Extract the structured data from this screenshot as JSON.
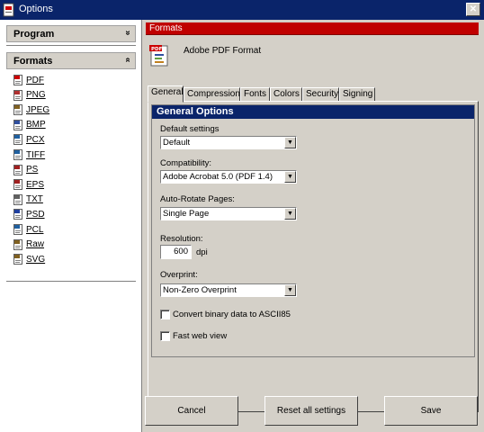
{
  "window": {
    "title": "Options",
    "close_glyph": "✕"
  },
  "sidebar": {
    "program_label": "Program",
    "program_chevron": "»",
    "formats_label": "Formats",
    "formats_chevron": "«",
    "formats": [
      {
        "label": "PDF",
        "icon": "pdf-file-icon",
        "color": "#cc0000"
      },
      {
        "label": "PNG",
        "icon": "png-file-icon",
        "color": "#b03030"
      },
      {
        "label": "JPEG",
        "icon": "jpeg-file-icon",
        "color": "#806020"
      },
      {
        "label": "BMP",
        "icon": "bmp-file-icon",
        "color": "#3050a0"
      },
      {
        "label": "PCX",
        "icon": "pcx-file-icon",
        "color": "#2060a0"
      },
      {
        "label": "TIFF",
        "icon": "tiff-file-icon",
        "color": "#2060a0"
      },
      {
        "label": "PS",
        "icon": "ps-file-icon",
        "color": "#a02020"
      },
      {
        "label": "EPS",
        "icon": "eps-file-icon",
        "color": "#a02020"
      },
      {
        "label": "TXT",
        "icon": "txt-file-icon",
        "color": "#606060"
      },
      {
        "label": "PSD",
        "icon": "psd-file-icon",
        "color": "#2040a0"
      },
      {
        "label": "PCL",
        "icon": "pcl-file-icon",
        "color": "#2060a0"
      },
      {
        "label": "Raw",
        "icon": "raw-file-icon",
        "color": "#806020"
      },
      {
        "label": "SVG",
        "icon": "svg-file-icon",
        "color": "#806020"
      }
    ]
  },
  "formats_header": {
    "title": "Formats",
    "format_name": "Adobe PDF Format",
    "icon_text": "PDF"
  },
  "tabs": [
    "General",
    "Compression",
    "Fonts",
    "Colors",
    "Security",
    "Signing"
  ],
  "general": {
    "group_title": "General Options",
    "default_settings": {
      "label": "Default settings",
      "value": "Default"
    },
    "compatibility": {
      "label": "Compatibility:",
      "value": "Adobe Acrobat 5.0 (PDF 1.4)"
    },
    "auto_rotate": {
      "label": "Auto-Rotate Pages:",
      "value": "Single Page"
    },
    "resolution": {
      "label": "Resolution:",
      "value": "600",
      "unit": "dpi"
    },
    "overprint": {
      "label": "Overprint:",
      "value": "Non-Zero Overprint"
    },
    "ascii85": {
      "label": "Convert binary data to ASCII85",
      "checked": false
    },
    "fast_web": {
      "label": "Fast web view",
      "checked": false
    }
  },
  "buttons": {
    "cancel": "Cancel",
    "reset": "Reset all settings",
    "save": "Save"
  },
  "colors": {
    "title_bar": "#0a246a",
    "formats_bar": "#c00000",
    "face": "#d4d0c8"
  }
}
